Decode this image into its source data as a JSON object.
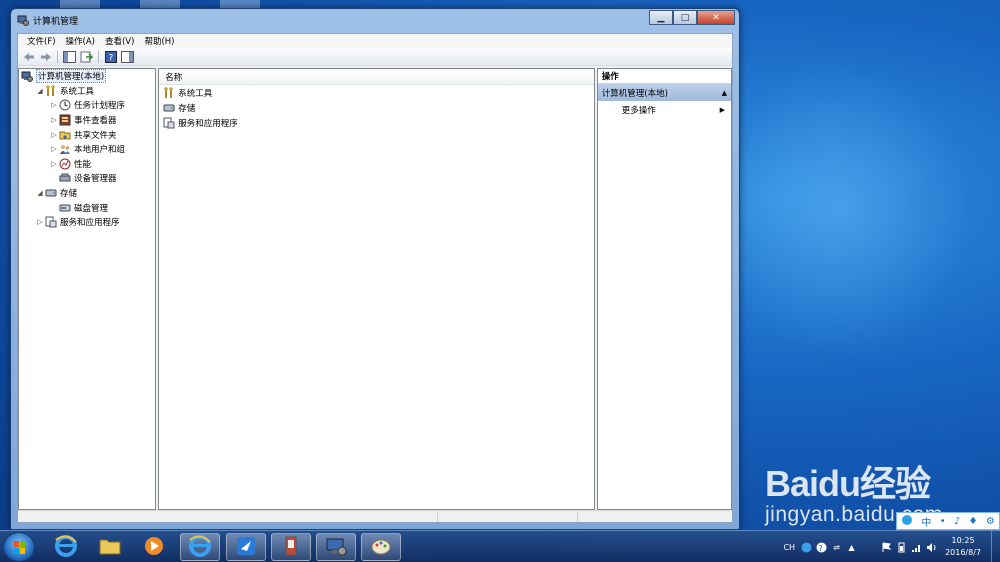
{
  "window": {
    "title": "计算机管理",
    "controls": {
      "minimize": "▁",
      "maximize": "□",
      "close": "✕"
    }
  },
  "menubar": [
    "文件(F)",
    "操作(A)",
    "查看(V)",
    "帮助(H)"
  ],
  "tree": [
    {
      "label": "计算机管理(本地)",
      "indent": 0,
      "arrow": "",
      "icon": "computer-management-icon"
    },
    {
      "label": "系统工具",
      "indent": 1,
      "arrow": "◢",
      "icon": "system-tools-icon"
    },
    {
      "label": "任务计划程序",
      "indent": 2,
      "arrow": "▷",
      "icon": "task-scheduler-icon"
    },
    {
      "label": "事件查看器",
      "indent": 2,
      "arrow": "▷",
      "icon": "event-viewer-icon"
    },
    {
      "label": "共享文件夹",
      "indent": 2,
      "arrow": "▷",
      "icon": "shared-folders-icon"
    },
    {
      "label": "本地用户和组",
      "indent": 2,
      "arrow": "▷",
      "icon": "local-users-icon"
    },
    {
      "label": "性能",
      "indent": 2,
      "arrow": "▷",
      "icon": "performance-icon"
    },
    {
      "label": "设备管理器",
      "indent": 2,
      "arrow": "",
      "icon": "device-manager-icon"
    },
    {
      "label": "存储",
      "indent": 1,
      "arrow": "◢",
      "icon": "storage-icon"
    },
    {
      "label": "磁盘管理",
      "indent": 2,
      "arrow": "",
      "icon": "disk-management-icon"
    },
    {
      "label": "服务和应用程序",
      "indent": 1,
      "arrow": "▷",
      "icon": "services-apps-icon"
    }
  ],
  "list": {
    "column_header": "名称",
    "items": [
      {
        "label": "系统工具",
        "icon": "system-tools-icon"
      },
      {
        "label": "存储",
        "icon": "storage-icon"
      },
      {
        "label": "服务和应用程序",
        "icon": "services-apps-icon"
      }
    ]
  },
  "actions": {
    "header": "操作",
    "group": "计算机管理(本地)",
    "group_arrow": "▲",
    "more": "更多操作",
    "more_arrow": "▶"
  },
  "taskbar": {
    "apps": [
      "ie-icon",
      "explorer-icon",
      "media-player-icon",
      "ie-icon",
      "feather-app-icon",
      "device-icon",
      "computer-management-icon",
      "paint-icon"
    ],
    "active_app": 6,
    "tray": {
      "lang": "CH",
      "time": "10:25",
      "date": "2016/8/7"
    }
  },
  "watermark": {
    "logo": "Baidu经验",
    "url": "jingyan.baidu.com"
  },
  "ime": {
    "label": "中"
  }
}
